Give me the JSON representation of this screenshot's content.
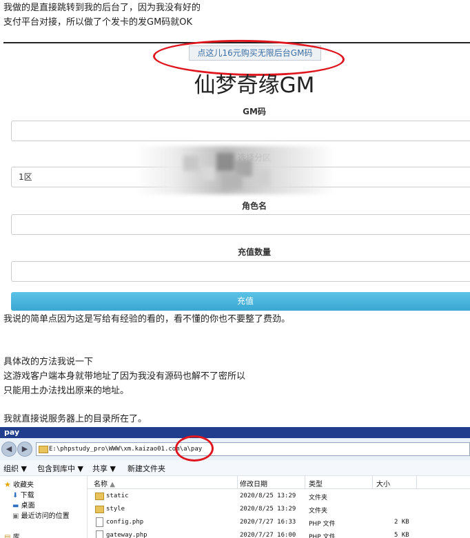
{
  "intro": {
    "line1": "我做的是直接跳转到我的后台了，因为我没有好的",
    "line2": "支付平台对接，所以做了个发卡的发GM码就OK"
  },
  "form": {
    "buy_link": "点这儿16元购买无限后台GM码",
    "title": "仙梦奇缘GM",
    "gm_code_label": "GM码",
    "gm_code_value": "",
    "server_label": "选择分区",
    "server_selected": "1区",
    "role_label": "角色名",
    "role_value": "",
    "amount_label": "充值数量",
    "amount_value": "",
    "submit_label": "充值"
  },
  "body_text": {
    "p1": "我说的简单点因为这是写给有经验的看的，看不懂的你也不要整了费劲。",
    "p2": "具体改的方法我说一下",
    "p3": "这游戏客户端本身就带地址了因为我没有源码也解不了密所以",
    "p4": "只能用土办法找出原来的地址。",
    "p5": "我就直接说服务器上的目录所在了。"
  },
  "explorer": {
    "window_title": "pay",
    "address": "E:\\phpstudy_pro\\WWW\\xm.kaizao01.com\\a\\pay",
    "toolbar": {
      "organize": "组织 ▼",
      "include_in_library": "包含到库中 ▼",
      "share": "共享 ▼",
      "new_folder": "新建文件夹"
    },
    "tree": {
      "favorites": "收藏夹",
      "downloads": "下载",
      "desktop": "桌面",
      "recent": "最近访问的位置",
      "library": "库"
    },
    "columns": {
      "name": "名称",
      "modified": "修改日期",
      "type": "类型",
      "size": "大小"
    },
    "files": [
      {
        "name": "static",
        "modified": "2020/8/25 13:29",
        "type": "文件夹",
        "size": ""
      },
      {
        "name": "style",
        "modified": "2020/8/25 13:29",
        "type": "文件夹",
        "size": ""
      },
      {
        "name": "config.php",
        "modified": "2020/7/27 16:33",
        "type": "PHP 文件",
        "size": "2 KB"
      },
      {
        "name": "gateway.php",
        "modified": "2020/7/27 16:00",
        "type": "PHP 文件",
        "size": "5 KB"
      }
    ]
  },
  "colors": {
    "submit": "#3aa7d3",
    "annotation_red": "#e0161e",
    "explorer_title": "#1f3c8d"
  }
}
